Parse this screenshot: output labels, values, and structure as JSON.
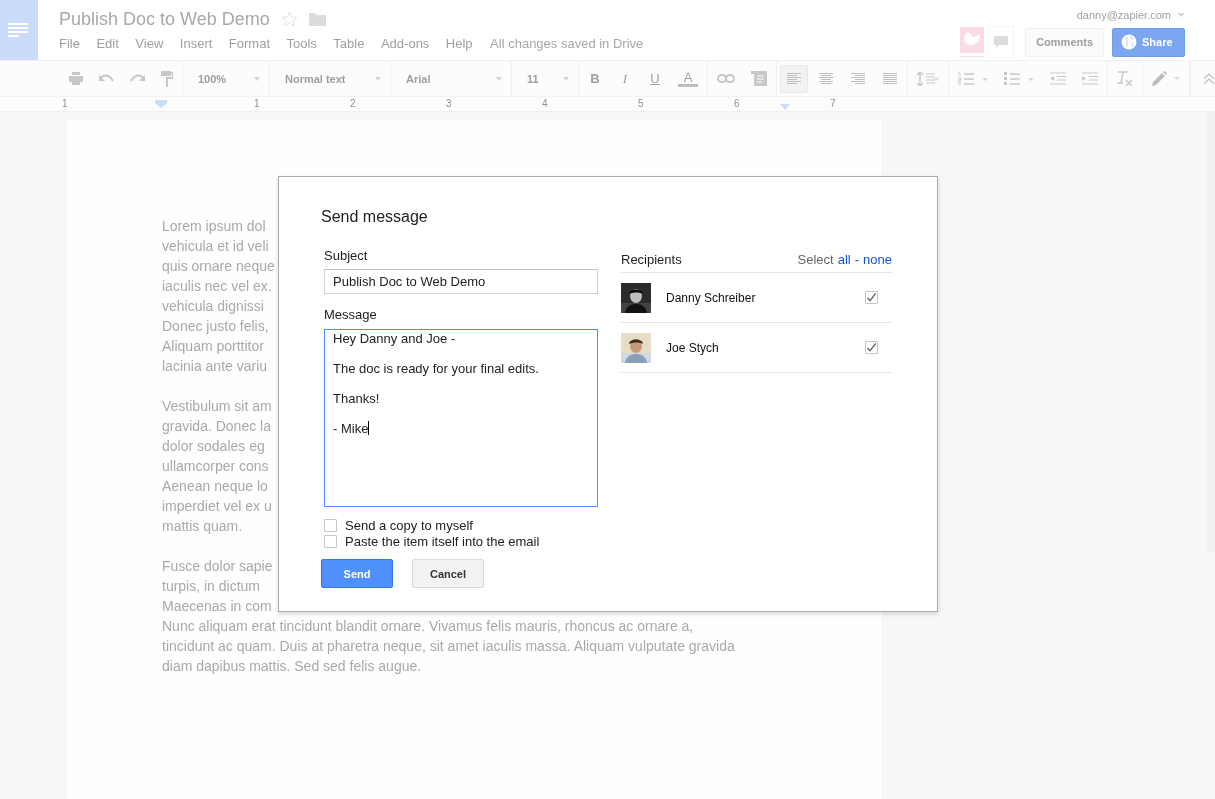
{
  "document": {
    "title": "Publish Doc to Web Demo",
    "menu": [
      "File",
      "Edit",
      "View",
      "Insert",
      "Format",
      "Tools",
      "Table",
      "Add-ons",
      "Help"
    ],
    "save_status": "All changes saved in Drive"
  },
  "account": {
    "email": "danny@zapier.com"
  },
  "header_buttons": {
    "comments": "Comments",
    "share": "Share"
  },
  "toolbar": {
    "zoom": "100%",
    "style": "Normal text",
    "font": "Arial",
    "size": "11",
    "bold": "B",
    "italic": "I",
    "underline": "U",
    "text_color": "A",
    "alignments": [
      {
        "selected": true
      },
      {
        "selected": false
      },
      {
        "selected": false
      },
      {
        "selected": false
      }
    ]
  },
  "ruler": [
    "1",
    "1",
    "2",
    "3",
    "4",
    "5",
    "6",
    "7"
  ],
  "paragraphs": [
    [
      "Lorem ipsum dol",
      "vehicula et id veli",
      "quis ornare neque",
      "iaculis nec vel ex.",
      "vehicula dignissi",
      "Donec justo felis,",
      "Aliquam porttitor",
      "lacinia ante variu"
    ],
    [
      "Vestibulum sit am",
      "gravida. Donec la",
      "dolor sodales eg",
      "ullamcorper cons",
      "Aenean neque lo",
      "imperdiet vel ex u",
      "mattis quam."
    ],
    [
      "Fusce dolor sapie",
      "turpis, in dictum",
      "Maecenas in com",
      "Nunc aliquam erat tincidunt blandit ornare. Vivamus felis mauris, rhoncus ac ornare a,",
      "tincidunt ac quam. Duis at pharetra neque, sit amet iaculis massa. Aliquam vulputate gravida",
      "diam dapibus mattis. Sed sed felis augue."
    ]
  ],
  "dialog": {
    "title": "Send message",
    "subject_label": "Subject",
    "subject": "Publish Doc to Web Demo",
    "message_label": "Message",
    "message": [
      "Hey Danny and Joe -",
      "The doc is ready for your final edits.",
      "Thanks!",
      "- Mike"
    ],
    "options": [
      {
        "label": "Send a copy to myself",
        "checked": false
      },
      {
        "label": "Paste the item itself into the email",
        "checked": false
      }
    ],
    "send": "Send",
    "cancel": "Cancel",
    "recipients_label": "Recipients",
    "select_label": "Select",
    "select_all": "all",
    "separator": "-",
    "select_none": "none",
    "recipients": [
      {
        "name": "Danny Schreiber",
        "checked": true
      },
      {
        "name": "Joe Stych",
        "checked": true
      }
    ]
  }
}
